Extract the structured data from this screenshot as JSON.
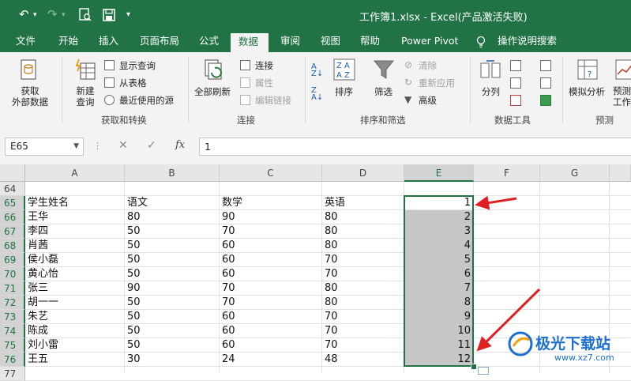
{
  "window": {
    "title": "工作簿1.xlsx  -  Excel(产品激活失败)"
  },
  "quick_access": {
    "undo_icon": "undo-icon",
    "redo_icon": "redo-icon",
    "print_preview_icon": "print-preview-icon",
    "save_icon": "save-icon",
    "customize_icon": "customize-quick-access-icon"
  },
  "tabs": [
    "文件",
    "开始",
    "插入",
    "页面布局",
    "公式",
    "数据",
    "审阅",
    "视图",
    "帮助",
    "Power Pivot",
    "操作说明搜索"
  ],
  "active_tab": "数据",
  "ribbon": {
    "get_external_data": "获取\n外部数据",
    "new_query": "新建\n查询",
    "show_queries": "显示查询",
    "from_table": "从表格",
    "recent_sources": "最近使用的源",
    "group_get_transform": "获取和转换",
    "refresh_all": "全部刷新",
    "connections": "连接",
    "properties": "属性",
    "edit_links": "编辑链接",
    "group_connections": "连接",
    "sort": "排序",
    "filter": "筛选",
    "clear": "清除",
    "reapply": "重新应用",
    "advanced": "高级",
    "group_sort_filter": "排序和筛选",
    "text_to_columns": "分列",
    "group_data_tools": "数据工具",
    "what_if": "模拟分析",
    "forecast_sheet": "预测\n工作表",
    "group_forecast": "预测"
  },
  "formula_bar": {
    "name_box": "E65",
    "cancel_symbol": "✕",
    "enter_symbol": "✓",
    "fx_symbol": "fx",
    "value": "1"
  },
  "sheet": {
    "columns": [
      "A",
      "B",
      "C",
      "D",
      "E",
      "F",
      "G"
    ],
    "selected_column": "E",
    "rows": [
      {
        "num": "64",
        "A": "",
        "B": "",
        "C": "",
        "D": "",
        "E": ""
      },
      {
        "num": "65",
        "A": "学生姓名",
        "B": "语文",
        "C": "数学",
        "D": "英语",
        "E": "1"
      },
      {
        "num": "66",
        "A": "王华",
        "B": "80",
        "C": "90",
        "D": "80",
        "E": "2"
      },
      {
        "num": "67",
        "A": "李四",
        "B": "50",
        "C": "70",
        "D": "80",
        "E": "3"
      },
      {
        "num": "68",
        "A": "肖茜",
        "B": "50",
        "C": "60",
        "D": "80",
        "E": "4"
      },
      {
        "num": "69",
        "A": "侯小磊",
        "B": "50",
        "C": "60",
        "D": "70",
        "E": "5"
      },
      {
        "num": "70",
        "A": "黄心怡",
        "B": "50",
        "C": "60",
        "D": "70",
        "E": "6"
      },
      {
        "num": "71",
        "A": "张三",
        "B": "90",
        "C": "70",
        "D": "80",
        "E": "7"
      },
      {
        "num": "72",
        "A": "胡一一",
        "B": "50",
        "C": "70",
        "D": "80",
        "E": "8"
      },
      {
        "num": "73",
        "A": "朱艺",
        "B": "50",
        "C": "60",
        "D": "70",
        "E": "9"
      },
      {
        "num": "74",
        "A": "陈成",
        "B": "50",
        "C": "60",
        "D": "70",
        "E": "10"
      },
      {
        "num": "75",
        "A": "刘小雷",
        "B": "50",
        "C": "60",
        "D": "70",
        "E": "11"
      },
      {
        "num": "76",
        "A": "王五",
        "B": "30",
        "C": "24",
        "D": "48",
        "E": "12"
      },
      {
        "num": "77",
        "A": "",
        "B": "",
        "C": "",
        "D": "",
        "E": ""
      }
    ]
  },
  "watermark": {
    "name": "极光下载站",
    "url": "www.xz7.com"
  },
  "colors": {
    "excel_green": "#217346",
    "arrow_red": "#e02020",
    "selection_fill": "#c6c6c6"
  }
}
